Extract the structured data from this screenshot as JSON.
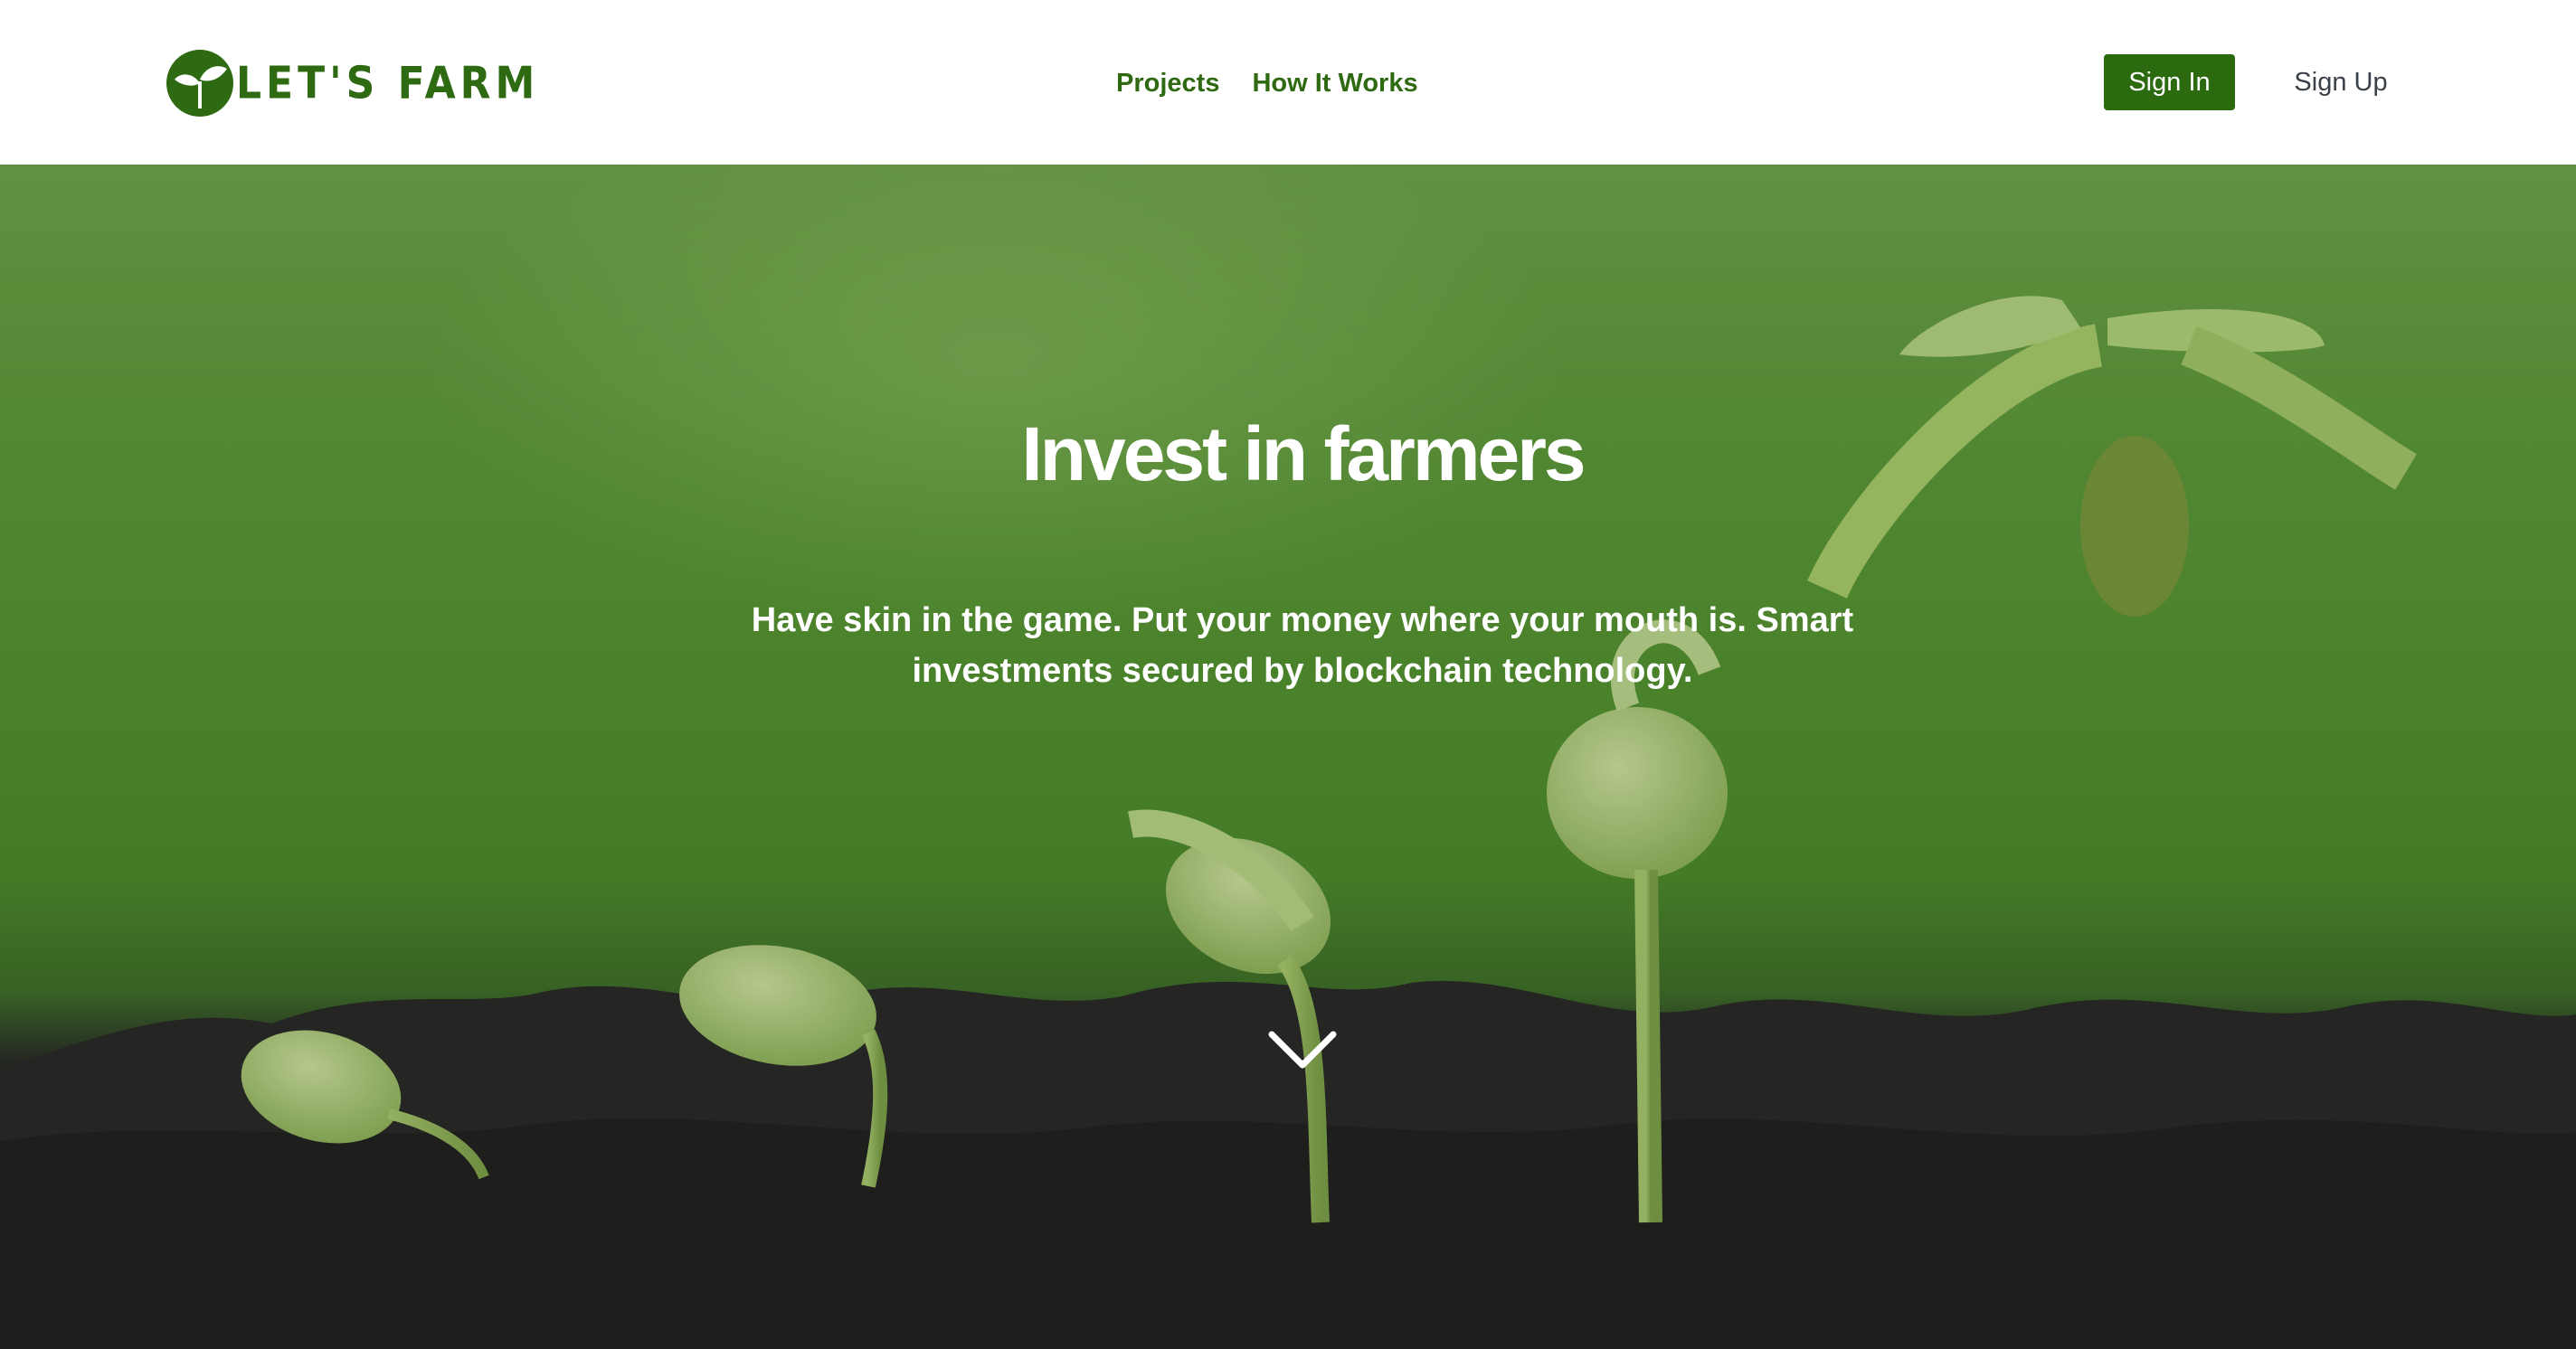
{
  "brand": {
    "name": "LET'S FARM",
    "icon": "sprout-leaf-icon",
    "color": "#2d6a12"
  },
  "nav": {
    "items": [
      {
        "label": "Projects"
      },
      {
        "label": "How It Works"
      }
    ],
    "color": "#2f6a12"
  },
  "auth": {
    "sign_in_label": "Sign In",
    "sign_up_label": "Sign Up",
    "sign_in_color": "#2b6a0e"
  },
  "hero": {
    "title": "Invest in farmers",
    "subtitle": "Have skin in the game. Put your money where your mouth is. Smart investments secured by blockchain technology.",
    "background": "seedlings-growing-in-soil-photo",
    "scroll_icon": "chevron-down-icon"
  }
}
